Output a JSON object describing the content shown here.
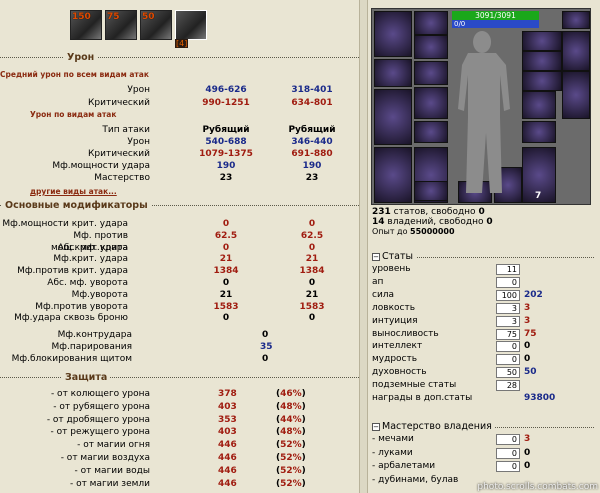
{
  "buffs": [
    {
      "n": "150",
      "c": ""
    },
    {
      "n": "75",
      "c": ""
    },
    {
      "n": "50",
      "c": ""
    },
    {
      "n": "",
      "c": "[4]"
    }
  ],
  "sections": {
    "damage": "Урон",
    "modifiers": "Основные модификаторы",
    "defense": "Защита"
  },
  "damage": {
    "avg_title": "Средний урон по всем видам атак",
    "rows": [
      {
        "label": "Урон",
        "a": "496-626",
        "b": "318-401",
        "cls": "bl"
      },
      {
        "label": "Критический",
        "a": "990-1251",
        "b": "634-801",
        "cls": "rd"
      }
    ],
    "by_type_title": "Урон по видам атак",
    "type_row": {
      "label": "Тип атаки",
      "a": "Рубящий",
      "b": "Рубящий"
    },
    "type_rows": [
      {
        "label": "Урон",
        "a": "540-688",
        "b": "346-440",
        "cls": "bl"
      },
      {
        "label": "Критический",
        "a": "1079-1375",
        "b": "691-880",
        "cls": "rd"
      },
      {
        "label": "Мф.мощности удара",
        "a": "190",
        "b": "190",
        "cls": "bl"
      },
      {
        "label": "Мастерство",
        "a": "23",
        "b": "23",
        "cls": "bk"
      }
    ],
    "other_link": "другие виды атак..."
  },
  "modifiers": [
    {
      "label": "Мф.мощности крит. удара",
      "a": "0",
      "b": "0",
      "cls": "rd"
    },
    {
      "label": "Мф. против мощ.крит.удара",
      "a": "62.5",
      "b": "62.5",
      "cls": "rd"
    },
    {
      "label": "Абс. мф. крита",
      "a": "0",
      "b": "0",
      "cls": "rd"
    },
    {
      "label": "Мф.крит. удара",
      "a": "21",
      "b": "21",
      "cls": "rd"
    },
    {
      "label": "Мф.против крит. удара",
      "a": "1384",
      "b": "1384",
      "cls": "rd"
    },
    {
      "label": "Абс. мф. уворота",
      "a": "0",
      "b": "0",
      "cls": "bk"
    },
    {
      "label": "Мф.уворота",
      "a": "21",
      "b": "21",
      "cls": "bk"
    },
    {
      "label": "Мф.против уворота",
      "a": "1583",
      "b": "1583",
      "cls": "rd"
    },
    {
      "label": "Мф.удара сквозь броню",
      "a": "0",
      "b": "0",
      "cls": "bk"
    }
  ],
  "modifiers2": [
    {
      "label": "Мф.контрудара",
      "v": "0",
      "cls": "bk"
    },
    {
      "label": "Мф.парирования",
      "v": "35",
      "cls": "bl"
    },
    {
      "label": "Мф.блокирования щитом",
      "v": "0",
      "cls": "bk"
    }
  ],
  "defense": [
    {
      "label": "- от колющего урона",
      "v": "378",
      "p": "46%"
    },
    {
      "label": "- от рубящего урона",
      "v": "403",
      "p": "48%"
    },
    {
      "label": "- от дробящего урона",
      "v": "353",
      "p": "44%"
    },
    {
      "label": "- от режущего урона",
      "v": "403",
      "p": "48%"
    },
    {
      "label": "- от магии огня",
      "v": "446",
      "p": "52%"
    },
    {
      "label": "- от магии воздуха",
      "v": "446",
      "p": "52%"
    },
    {
      "label": "- от магии воды",
      "v": "446",
      "p": "52%"
    },
    {
      "label": "- от магии земли",
      "v": "446",
      "p": "52%"
    }
  ],
  "char": {
    "hp": "3091/3091",
    "mp": "0/0",
    "slot7": "7"
  },
  "info": {
    "stats": "231",
    "stats_txt": " статов, свободно ",
    "stats_free": "0",
    "skills": "14",
    "skills_txt": " владений, свободно ",
    "skills_free": "0",
    "exp_lbl": "Опыт до ",
    "exp": "55000000"
  },
  "stats_head": "Статы",
  "stats": [
    {
      "name": "уровень",
      "inp": "11",
      "v": "",
      "cls": ""
    },
    {
      "name": "ап",
      "inp": "0",
      "v": "",
      "cls": ""
    },
    {
      "name": "сила",
      "inp": "100",
      "v": "202",
      "cls": "bl"
    },
    {
      "name": "ловкость",
      "inp": "3",
      "v": "3",
      "cls": "rd"
    },
    {
      "name": "интуиция",
      "inp": "3",
      "v": "3",
      "cls": "rd"
    },
    {
      "name": "выносливость",
      "inp": "75",
      "v": "75",
      "cls": "rd"
    },
    {
      "name": "интеллект",
      "inp": "0",
      "v": "0",
      "cls": "bk"
    },
    {
      "name": "мудрость",
      "inp": "0",
      "v": "0",
      "cls": "bk"
    },
    {
      "name": "духовность",
      "inp": "50",
      "v": "50",
      "cls": "bl"
    },
    {
      "name": "подземные статы",
      "inp": "28",
      "v": "",
      "cls": ""
    },
    {
      "name": "награды в доп.статы",
      "inp": "",
      "v": "93800",
      "cls": "bl"
    }
  ],
  "mastery_head": "Мастерство владения",
  "mastery": [
    {
      "name": "- мечами",
      "inp": "0",
      "v": "3",
      "cls": "rd"
    },
    {
      "name": "- луками",
      "inp": "0",
      "v": "0",
      "cls": "bk"
    },
    {
      "name": "- арбалетами",
      "inp": "0",
      "v": "0",
      "cls": "bk"
    },
    {
      "name": "- дубинами, булав",
      "inp": "",
      "v": "",
      "cls": ""
    }
  ],
  "watermark": "photo.scrolls.combats.com"
}
